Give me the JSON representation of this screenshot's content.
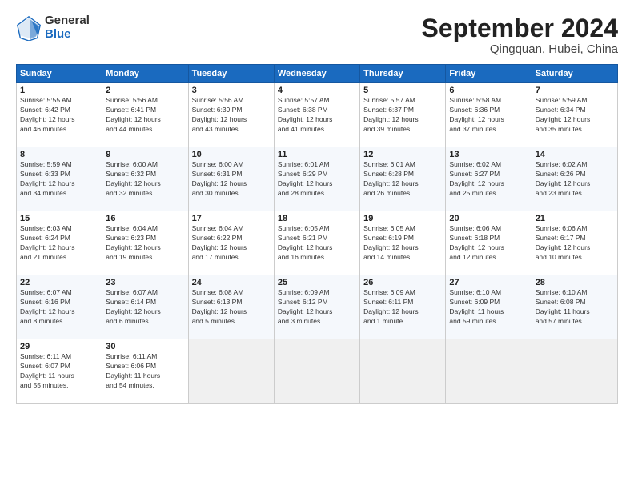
{
  "header": {
    "logo_general": "General",
    "logo_blue": "Blue",
    "month": "September 2024",
    "location": "Qingquan, Hubei, China"
  },
  "weekdays": [
    "Sunday",
    "Monday",
    "Tuesday",
    "Wednesday",
    "Thursday",
    "Friday",
    "Saturday"
  ],
  "weeks": [
    [
      {
        "day": "1",
        "info": "Sunrise: 5:55 AM\nSunset: 6:42 PM\nDaylight: 12 hours\nand 46 minutes."
      },
      {
        "day": "2",
        "info": "Sunrise: 5:56 AM\nSunset: 6:41 PM\nDaylight: 12 hours\nand 44 minutes."
      },
      {
        "day": "3",
        "info": "Sunrise: 5:56 AM\nSunset: 6:39 PM\nDaylight: 12 hours\nand 43 minutes."
      },
      {
        "day": "4",
        "info": "Sunrise: 5:57 AM\nSunset: 6:38 PM\nDaylight: 12 hours\nand 41 minutes."
      },
      {
        "day": "5",
        "info": "Sunrise: 5:57 AM\nSunset: 6:37 PM\nDaylight: 12 hours\nand 39 minutes."
      },
      {
        "day": "6",
        "info": "Sunrise: 5:58 AM\nSunset: 6:36 PM\nDaylight: 12 hours\nand 37 minutes."
      },
      {
        "day": "7",
        "info": "Sunrise: 5:59 AM\nSunset: 6:34 PM\nDaylight: 12 hours\nand 35 minutes."
      }
    ],
    [
      {
        "day": "8",
        "info": "Sunrise: 5:59 AM\nSunset: 6:33 PM\nDaylight: 12 hours\nand 34 minutes."
      },
      {
        "day": "9",
        "info": "Sunrise: 6:00 AM\nSunset: 6:32 PM\nDaylight: 12 hours\nand 32 minutes."
      },
      {
        "day": "10",
        "info": "Sunrise: 6:00 AM\nSunset: 6:31 PM\nDaylight: 12 hours\nand 30 minutes."
      },
      {
        "day": "11",
        "info": "Sunrise: 6:01 AM\nSunset: 6:29 PM\nDaylight: 12 hours\nand 28 minutes."
      },
      {
        "day": "12",
        "info": "Sunrise: 6:01 AM\nSunset: 6:28 PM\nDaylight: 12 hours\nand 26 minutes."
      },
      {
        "day": "13",
        "info": "Sunrise: 6:02 AM\nSunset: 6:27 PM\nDaylight: 12 hours\nand 25 minutes."
      },
      {
        "day": "14",
        "info": "Sunrise: 6:02 AM\nSunset: 6:26 PM\nDaylight: 12 hours\nand 23 minutes."
      }
    ],
    [
      {
        "day": "15",
        "info": "Sunrise: 6:03 AM\nSunset: 6:24 PM\nDaylight: 12 hours\nand 21 minutes."
      },
      {
        "day": "16",
        "info": "Sunrise: 6:04 AM\nSunset: 6:23 PM\nDaylight: 12 hours\nand 19 minutes."
      },
      {
        "day": "17",
        "info": "Sunrise: 6:04 AM\nSunset: 6:22 PM\nDaylight: 12 hours\nand 17 minutes."
      },
      {
        "day": "18",
        "info": "Sunrise: 6:05 AM\nSunset: 6:21 PM\nDaylight: 12 hours\nand 16 minutes."
      },
      {
        "day": "19",
        "info": "Sunrise: 6:05 AM\nSunset: 6:19 PM\nDaylight: 12 hours\nand 14 minutes."
      },
      {
        "day": "20",
        "info": "Sunrise: 6:06 AM\nSunset: 6:18 PM\nDaylight: 12 hours\nand 12 minutes."
      },
      {
        "day": "21",
        "info": "Sunrise: 6:06 AM\nSunset: 6:17 PM\nDaylight: 12 hours\nand 10 minutes."
      }
    ],
    [
      {
        "day": "22",
        "info": "Sunrise: 6:07 AM\nSunset: 6:16 PM\nDaylight: 12 hours\nand 8 minutes."
      },
      {
        "day": "23",
        "info": "Sunrise: 6:07 AM\nSunset: 6:14 PM\nDaylight: 12 hours\nand 6 minutes."
      },
      {
        "day": "24",
        "info": "Sunrise: 6:08 AM\nSunset: 6:13 PM\nDaylight: 12 hours\nand 5 minutes."
      },
      {
        "day": "25",
        "info": "Sunrise: 6:09 AM\nSunset: 6:12 PM\nDaylight: 12 hours\nand 3 minutes."
      },
      {
        "day": "26",
        "info": "Sunrise: 6:09 AM\nSunset: 6:11 PM\nDaylight: 12 hours\nand 1 minute."
      },
      {
        "day": "27",
        "info": "Sunrise: 6:10 AM\nSunset: 6:09 PM\nDaylight: 11 hours\nand 59 minutes."
      },
      {
        "day": "28",
        "info": "Sunrise: 6:10 AM\nSunset: 6:08 PM\nDaylight: 11 hours\nand 57 minutes."
      }
    ],
    [
      {
        "day": "29",
        "info": "Sunrise: 6:11 AM\nSunset: 6:07 PM\nDaylight: 11 hours\nand 55 minutes."
      },
      {
        "day": "30",
        "info": "Sunrise: 6:11 AM\nSunset: 6:06 PM\nDaylight: 11 hours\nand 54 minutes."
      },
      {
        "day": "",
        "info": ""
      },
      {
        "day": "",
        "info": ""
      },
      {
        "day": "",
        "info": ""
      },
      {
        "day": "",
        "info": ""
      },
      {
        "day": "",
        "info": ""
      }
    ]
  ]
}
